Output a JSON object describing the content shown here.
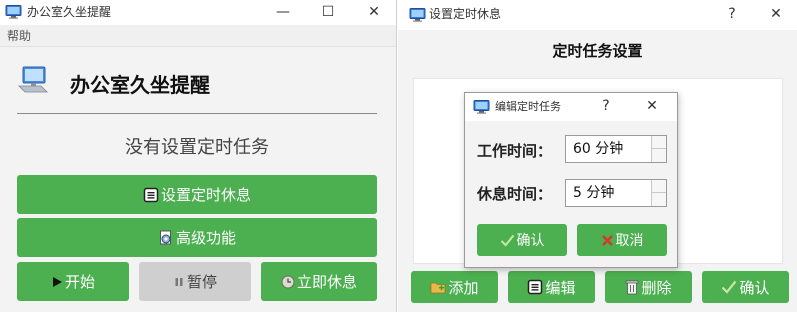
{
  "window_main": {
    "title": "办公室久坐提醒",
    "menu": [
      "帮助"
    ],
    "app_title": "办公室久坐提醒",
    "status_text": "没有设置定时任务",
    "buttons": {
      "set_timer": "设置定时休息",
      "advanced": "高级功能",
      "start": "开始",
      "pause": "暂停",
      "rest_now": "立即休息"
    }
  },
  "window_timer": {
    "title": "设置定时休息",
    "help": "?",
    "panel_title": "定时任务设置",
    "buttons": {
      "add": "添加",
      "edit": "编辑",
      "delete": "删除",
      "confirm": "确认"
    }
  },
  "dialog_edit": {
    "title": "编辑定时任务",
    "help": "?",
    "work_label": "工作时间：",
    "work_value": "60 分钟",
    "rest_label": "休息时间：",
    "rest_value": "5 分钟",
    "ok": "确认",
    "cancel": "取消"
  },
  "colors": {
    "accent_green": "#4caf50",
    "disabled_gray": "#cfcfcf",
    "window_bg": "#f3f3f3"
  },
  "icons": [
    "monitor-icon",
    "minimize-icon",
    "maximize-icon",
    "close-icon",
    "document-icon",
    "gear-doc-icon",
    "play-icon",
    "pause-icon",
    "clock-icon",
    "folder-add-icon",
    "edit-icon",
    "trash-icon",
    "checkmark-icon",
    "cross-icon",
    "help-icon"
  ]
}
